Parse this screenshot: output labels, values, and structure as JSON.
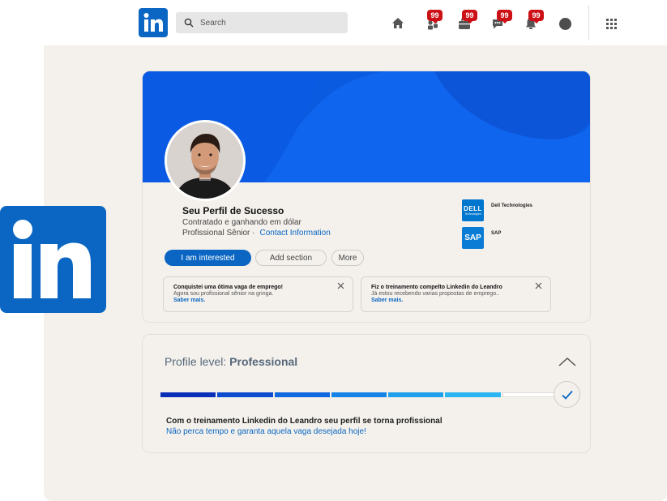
{
  "navbar": {
    "logo_text": "in",
    "search_placeholder": "Search",
    "badges": [
      "99",
      "99",
      "99",
      "99"
    ]
  },
  "profile": {
    "name": "Seu Perfil de Sucesso",
    "headline": "Contratado e ganhando em dólar",
    "level_line": "Profissional Sênior ·",
    "contact_link": "Contact Information",
    "companies": [
      {
        "name": "Dell Technologies",
        "logo_text": "DELL",
        "logo_sub": "Technologies",
        "color": "#0076ce"
      },
      {
        "name": "SAP",
        "logo_text": "SAP",
        "color": "#0a7cd6"
      }
    ],
    "buttons": {
      "primary": "I am interested",
      "add_section": "Add section",
      "more": "More"
    },
    "notices": [
      {
        "title": "Conquistei uma ótima vaga de emprego!",
        "desc": "Agora sou profissional sênior na gringa.",
        "more": "Saber mais."
      },
      {
        "title": "Fiz o treinamento compelto Linkedin do Leandro",
        "desc": "Já estou recebendo varias propostas de emprego..",
        "more": "Saber mais."
      }
    ]
  },
  "profile_level": {
    "label": "Profile level:",
    "value": "Professional",
    "progress_segments_filled": 6,
    "progress_segments_total": 7,
    "segment_colors": [
      "#0a2fb8",
      "#0d4bd1",
      "#1068de",
      "#1583e6",
      "#1fa0ec",
      "#2bb6f2"
    ],
    "message": "Com o treinamento Linkedin do Leandro seu perfil se torna profissional",
    "sub_message": "Não perca tempo e garanta aquela vaga desejada hoje!"
  },
  "colors": {
    "brand": "#0a66c2",
    "badge": "#cc1016",
    "panel": "#f4f1ec"
  },
  "icons": [
    "search-icon",
    "home-icon",
    "network-icon",
    "jobs-icon",
    "messaging-icon",
    "notifications-icon",
    "apps-grid-icon",
    "close-icon",
    "chevron-up-icon",
    "check-icon"
  ]
}
